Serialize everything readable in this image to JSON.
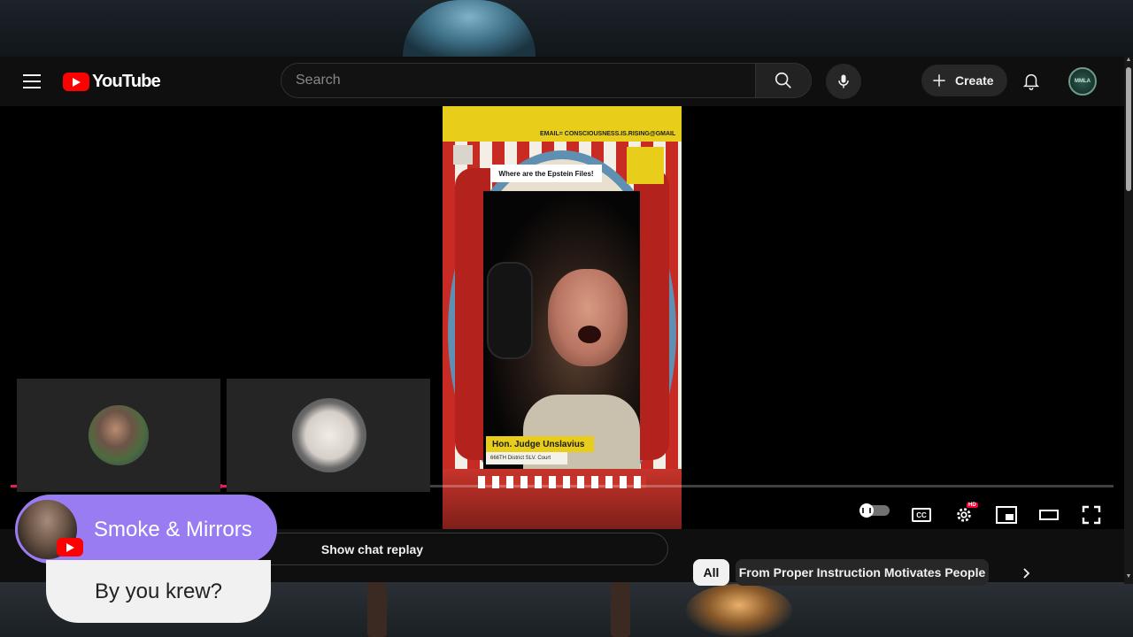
{
  "masthead": {
    "logo_text": "YouTube",
    "search_placeholder": "Search",
    "create_label": "Create",
    "avatar_initials": "MMLA"
  },
  "video": {
    "email_banner": "EMAIL= CONSCIOUSNESS.IS.RISING@GMAIL",
    "caption": "Where are the Epstein Files!",
    "lower_third_name": "Hon. Judge Unslavius",
    "lower_third_sub": "666TH District SLV. Court",
    "progress_fraction": 0.19
  },
  "player_controls": {
    "cc_label": "CC",
    "hd_badge": "HD"
  },
  "chat": {
    "show_replay_label": "Show chat replay"
  },
  "chips": {
    "all_label": "All",
    "from_label": "From Proper Instruction Motivates People"
  },
  "overlay": {
    "channel_name": "Smoke & Mirrors",
    "message": "By you krew?"
  },
  "colors": {
    "brand_red": "#ff0000",
    "accent_purple": "#9a7cf2",
    "progress_red": "#ff0033"
  }
}
